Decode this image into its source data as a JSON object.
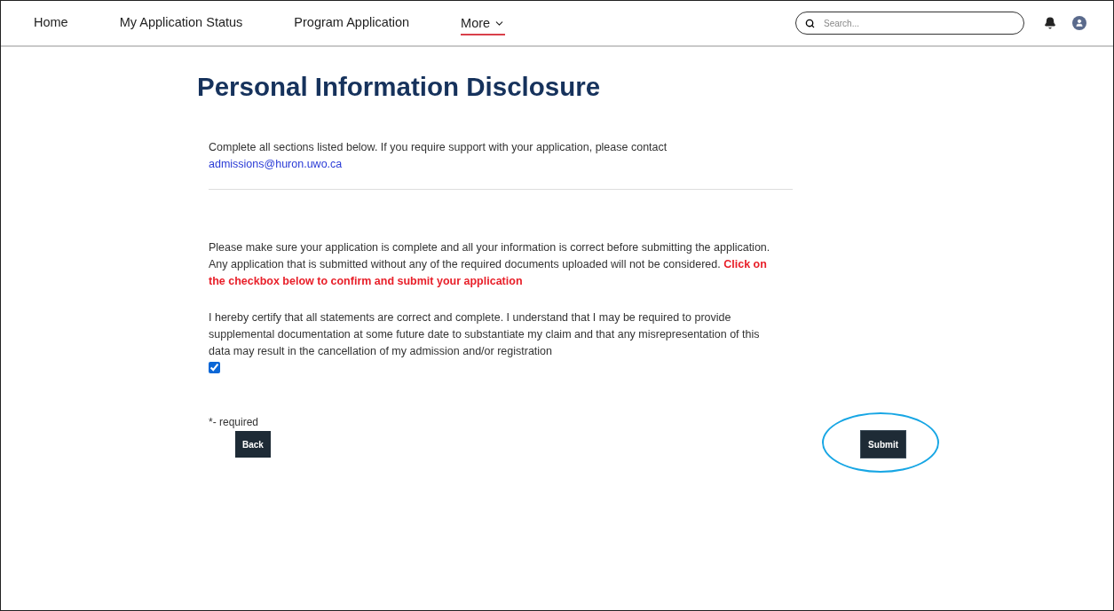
{
  "nav": {
    "items": [
      {
        "label": "Home",
        "kind": "link",
        "selected": false
      },
      {
        "label": "My Application Status",
        "kind": "link",
        "selected": false
      },
      {
        "label": "Program Application",
        "kind": "link",
        "selected": false
      },
      {
        "label": "More",
        "kind": "menu",
        "selected": true
      }
    ],
    "search": {
      "placeholder": "Search..."
    }
  },
  "page": {
    "title": "Personal Information Disclosure",
    "intro": "Complete all sections listed below. If you require support with your application, please contact",
    "contact_email": "admissions@huron.uwo.ca",
    "notice": "Please make sure your application is complete and all your information is correct before submitting the application. Any application that is submitted without any of the required documents uploaded will not be considered.",
    "notice_emphasis": "Click on the checkbox below to confirm and submit your application",
    "certification": {
      "text": "I hereby certify that all statements are correct and complete. I understand that I may be required to provide supplemental documentation at some future date to substantiate my claim and that any misrepresentation of this data may result in the cancellation of my admission and/or registration",
      "checked": true
    },
    "required_note": "*- required",
    "buttons": [
      {
        "label": "Back",
        "highlighted": false
      },
      {
        "label": "Submit",
        "highlighted": true
      }
    ]
  }
}
